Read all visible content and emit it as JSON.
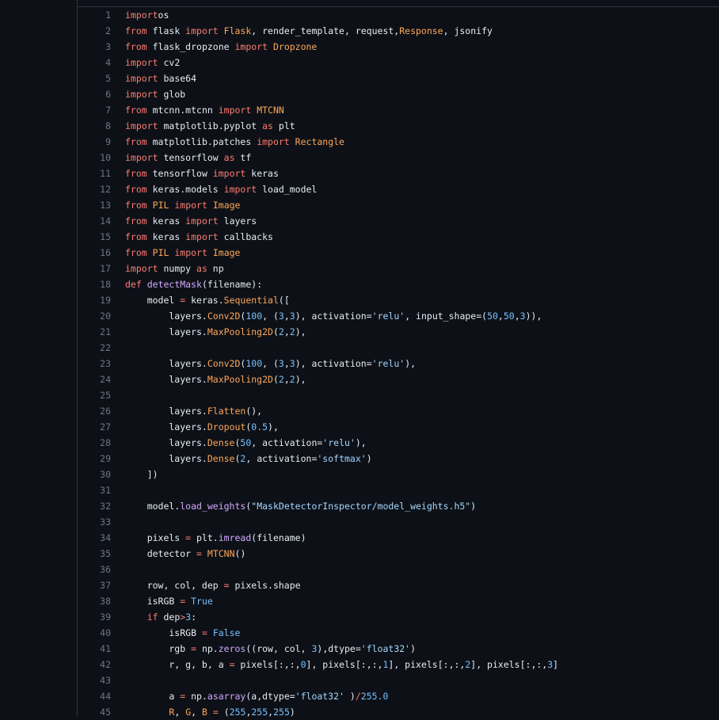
{
  "editor": {
    "lines": [
      {
        "n": "1",
        "t": [
          [
            "kw",
            "import"
          ],
          [
            "",
            "os"
          ]
        ]
      },
      {
        "n": "2",
        "t": [
          [
            "kw",
            "from"
          ],
          [
            "",
            " flask "
          ],
          [
            "kw",
            "import"
          ],
          [
            "",
            " "
          ],
          [
            "cls",
            "Flask"
          ],
          [
            "",
            ", render_template, request,"
          ],
          [
            "cls",
            "Response"
          ],
          [
            "",
            ", jsonify"
          ]
        ]
      },
      {
        "n": "3",
        "t": [
          [
            "kw",
            "from"
          ],
          [
            "",
            " flask_dropzone "
          ],
          [
            "kw",
            "import"
          ],
          [
            "",
            " "
          ],
          [
            "cls",
            "Dropzone"
          ]
        ]
      },
      {
        "n": "4",
        "t": [
          [
            "kw",
            "import"
          ],
          [
            "",
            " cv2"
          ]
        ]
      },
      {
        "n": "5",
        "t": [
          [
            "kw",
            "import"
          ],
          [
            "",
            " base64"
          ]
        ]
      },
      {
        "n": "6",
        "t": [
          [
            "kw",
            "import"
          ],
          [
            "",
            " glob"
          ]
        ]
      },
      {
        "n": "7",
        "t": [
          [
            "kw",
            "from"
          ],
          [
            "",
            " mtcnn.mtcnn "
          ],
          [
            "kw",
            "import"
          ],
          [
            "",
            " "
          ],
          [
            "cls",
            "MTCNN"
          ]
        ]
      },
      {
        "n": "8",
        "t": [
          [
            "kw",
            "import"
          ],
          [
            "",
            " matplotlib.pyplot "
          ],
          [
            "kw",
            "as"
          ],
          [
            "",
            " plt"
          ]
        ]
      },
      {
        "n": "9",
        "t": [
          [
            "kw",
            "from"
          ],
          [
            "",
            " matplotlib.patches "
          ],
          [
            "kw",
            "import"
          ],
          [
            "",
            " "
          ],
          [
            "cls",
            "Rectangle"
          ]
        ]
      },
      {
        "n": "10",
        "t": [
          [
            "kw",
            "import"
          ],
          [
            "",
            " tensorflow "
          ],
          [
            "kw",
            "as"
          ],
          [
            "",
            " tf"
          ]
        ]
      },
      {
        "n": "11",
        "t": [
          [
            "kw",
            "from"
          ],
          [
            "",
            " tensorflow "
          ],
          [
            "kw",
            "import"
          ],
          [
            "",
            " keras"
          ]
        ]
      },
      {
        "n": "12",
        "t": [
          [
            "kw",
            "from"
          ],
          [
            "",
            " keras.models "
          ],
          [
            "kw",
            "import"
          ],
          [
            "",
            " load_model"
          ]
        ]
      },
      {
        "n": "13",
        "t": [
          [
            "kw",
            "from"
          ],
          [
            "",
            " "
          ],
          [
            "cls",
            "PIL"
          ],
          [
            "",
            " "
          ],
          [
            "kw",
            "import"
          ],
          [
            "",
            " "
          ],
          [
            "cls",
            "Image"
          ]
        ]
      },
      {
        "n": "14",
        "t": [
          [
            "kw",
            "from"
          ],
          [
            "",
            " keras "
          ],
          [
            "kw",
            "import"
          ],
          [
            "",
            " layers"
          ]
        ]
      },
      {
        "n": "15",
        "t": [
          [
            "kw",
            "from"
          ],
          [
            "",
            " keras "
          ],
          [
            "kw",
            "import"
          ],
          [
            "",
            " callbacks"
          ]
        ]
      },
      {
        "n": "16",
        "t": [
          [
            "kw",
            "from"
          ],
          [
            "",
            " "
          ],
          [
            "cls",
            "PIL"
          ],
          [
            "",
            " "
          ],
          [
            "kw",
            "import"
          ],
          [
            "",
            " "
          ],
          [
            "cls",
            "Image"
          ]
        ]
      },
      {
        "n": "17",
        "t": [
          [
            "kw",
            "import"
          ],
          [
            "",
            " numpy "
          ],
          [
            "kw",
            "as"
          ],
          [
            "",
            " np"
          ]
        ]
      },
      {
        "n": "18",
        "t": [
          [
            "kw",
            "def"
          ],
          [
            "",
            " "
          ],
          [
            "fn",
            "detectMask"
          ],
          [
            "",
            "(filename):"
          ]
        ]
      },
      {
        "n": "19",
        "t": [
          [
            "",
            "    model "
          ],
          [
            "kw",
            "="
          ],
          [
            "",
            " keras."
          ],
          [
            "cls",
            "Sequential"
          ],
          [
            "",
            "(["
          ]
        ]
      },
      {
        "n": "20",
        "t": [
          [
            "",
            "        layers."
          ],
          [
            "cls",
            "Conv2D"
          ],
          [
            "",
            "("
          ],
          [
            "num",
            "100"
          ],
          [
            "",
            ", ("
          ],
          [
            "num",
            "3"
          ],
          [
            "",
            ","
          ],
          [
            "num",
            "3"
          ],
          [
            "",
            "), activation="
          ],
          [
            "str",
            "'relu'"
          ],
          [
            "",
            ", input_shape=("
          ],
          [
            "num",
            "50"
          ],
          [
            "",
            ","
          ],
          [
            "num",
            "50"
          ],
          [
            "",
            ","
          ],
          [
            "num",
            "3"
          ],
          [
            "",
            ")),"
          ]
        ]
      },
      {
        "n": "21",
        "t": [
          [
            "",
            "        layers."
          ],
          [
            "cls",
            "MaxPooling2D"
          ],
          [
            "",
            "("
          ],
          [
            "num",
            "2"
          ],
          [
            "",
            ","
          ],
          [
            "num",
            "2"
          ],
          [
            "",
            "),"
          ]
        ]
      },
      {
        "n": "22",
        "t": []
      },
      {
        "n": "23",
        "t": [
          [
            "",
            "        layers."
          ],
          [
            "cls",
            "Conv2D"
          ],
          [
            "",
            "("
          ],
          [
            "num",
            "100"
          ],
          [
            "",
            ", ("
          ],
          [
            "num",
            "3"
          ],
          [
            "",
            ","
          ],
          [
            "num",
            "3"
          ],
          [
            "",
            "), activation="
          ],
          [
            "str",
            "'relu'"
          ],
          [
            "",
            "),"
          ]
        ]
      },
      {
        "n": "24",
        "t": [
          [
            "",
            "        layers."
          ],
          [
            "cls",
            "MaxPooling2D"
          ],
          [
            "",
            "("
          ],
          [
            "num",
            "2"
          ],
          [
            "",
            ","
          ],
          [
            "num",
            "2"
          ],
          [
            "",
            "),"
          ]
        ]
      },
      {
        "n": "25",
        "t": []
      },
      {
        "n": "26",
        "t": [
          [
            "",
            "        layers."
          ],
          [
            "cls",
            "Flatten"
          ],
          [
            "",
            "(),"
          ]
        ]
      },
      {
        "n": "27",
        "t": [
          [
            "",
            "        layers."
          ],
          [
            "cls",
            "Dropout"
          ],
          [
            "",
            "("
          ],
          [
            "num",
            "0.5"
          ],
          [
            "",
            "),"
          ]
        ]
      },
      {
        "n": "28",
        "t": [
          [
            "",
            "        layers."
          ],
          [
            "cls",
            "Dense"
          ],
          [
            "",
            "("
          ],
          [
            "num",
            "50"
          ],
          [
            "",
            ", activation="
          ],
          [
            "str",
            "'relu'"
          ],
          [
            "",
            "),"
          ]
        ]
      },
      {
        "n": "29",
        "t": [
          [
            "",
            "        layers."
          ],
          [
            "cls",
            "Dense"
          ],
          [
            "",
            "("
          ],
          [
            "num",
            "2"
          ],
          [
            "",
            ", activation="
          ],
          [
            "str",
            "'softmax'"
          ],
          [
            "",
            ")"
          ]
        ]
      },
      {
        "n": "30",
        "t": [
          [
            "",
            "    ])"
          ]
        ]
      },
      {
        "n": "31",
        "t": []
      },
      {
        "n": "32",
        "t": [
          [
            "",
            "    model."
          ],
          [
            "fn",
            "load_weights"
          ],
          [
            "",
            "("
          ],
          [
            "str",
            "\"MaskDetectorInspector/model_weights.h5\""
          ],
          [
            "",
            ")"
          ]
        ]
      },
      {
        "n": "33",
        "t": []
      },
      {
        "n": "34",
        "t": [
          [
            "",
            "    pixels "
          ],
          [
            "kw",
            "="
          ],
          [
            "",
            " plt."
          ],
          [
            "fn",
            "imread"
          ],
          [
            "",
            "(filename)"
          ]
        ]
      },
      {
        "n": "35",
        "t": [
          [
            "",
            "    detector "
          ],
          [
            "kw",
            "="
          ],
          [
            "",
            " "
          ],
          [
            "cls",
            "MTCNN"
          ],
          [
            "",
            "()"
          ]
        ]
      },
      {
        "n": "36",
        "t": []
      },
      {
        "n": "37",
        "t": [
          [
            "",
            "    row, col, dep "
          ],
          [
            "kw",
            "="
          ],
          [
            "",
            " pixels.shape"
          ]
        ]
      },
      {
        "n": "38",
        "t": [
          [
            "",
            "    isRGB "
          ],
          [
            "kw",
            "="
          ],
          [
            "",
            " "
          ],
          [
            "const",
            "True"
          ]
        ]
      },
      {
        "n": "39",
        "t": [
          [
            "",
            "    "
          ],
          [
            "kw",
            "if"
          ],
          [
            "",
            " dep"
          ],
          [
            "kw",
            ">"
          ],
          [
            "num",
            "3"
          ],
          [
            "",
            ":"
          ]
        ]
      },
      {
        "n": "40",
        "t": [
          [
            "",
            "        isRGB "
          ],
          [
            "kw",
            "="
          ],
          [
            "",
            " "
          ],
          [
            "const",
            "False"
          ]
        ]
      },
      {
        "n": "41",
        "t": [
          [
            "",
            "        rgb "
          ],
          [
            "kw",
            "="
          ],
          [
            "",
            " np."
          ],
          [
            "fn",
            "zeros"
          ],
          [
            "",
            "((row, col, "
          ],
          [
            "num",
            "3"
          ],
          [
            "",
            "),dtype="
          ],
          [
            "str",
            "'float32'"
          ],
          [
            "",
            ")"
          ]
        ]
      },
      {
        "n": "42",
        "t": [
          [
            "",
            "        r, g, b, a "
          ],
          [
            "kw",
            "="
          ],
          [
            "",
            " pixels[:,:,"
          ],
          [
            "num",
            "0"
          ],
          [
            "",
            "], pixels[:,:,"
          ],
          [
            "num",
            "1"
          ],
          [
            "",
            "], pixels[:,:,"
          ],
          [
            "num",
            "2"
          ],
          [
            "",
            "], pixels[:,:,"
          ],
          [
            "num",
            "3"
          ],
          [
            "",
            "]"
          ]
        ]
      },
      {
        "n": "43",
        "t": []
      },
      {
        "n": "44",
        "t": [
          [
            "",
            "        a "
          ],
          [
            "kw",
            "="
          ],
          [
            "",
            " np."
          ],
          [
            "fn",
            "asarray"
          ],
          [
            "",
            "(a,dtype="
          ],
          [
            "str",
            "'float32'"
          ],
          [
            "",
            " )"
          ],
          [
            "kw",
            "/"
          ],
          [
            "num",
            "255.0"
          ]
        ]
      },
      {
        "n": "45",
        "t": [
          [
            "",
            "        "
          ],
          [
            "cls",
            "R"
          ],
          [
            "",
            ", "
          ],
          [
            "cls",
            "G"
          ],
          [
            "",
            ", "
          ],
          [
            "cls",
            "B"
          ],
          [
            "",
            " "
          ],
          [
            "kw",
            "="
          ],
          [
            "",
            " ("
          ],
          [
            "num",
            "255"
          ],
          [
            "",
            ","
          ],
          [
            "num",
            "255"
          ],
          [
            "",
            ","
          ],
          [
            "num",
            "255"
          ],
          [
            "",
            ")"
          ]
        ]
      }
    ]
  }
}
